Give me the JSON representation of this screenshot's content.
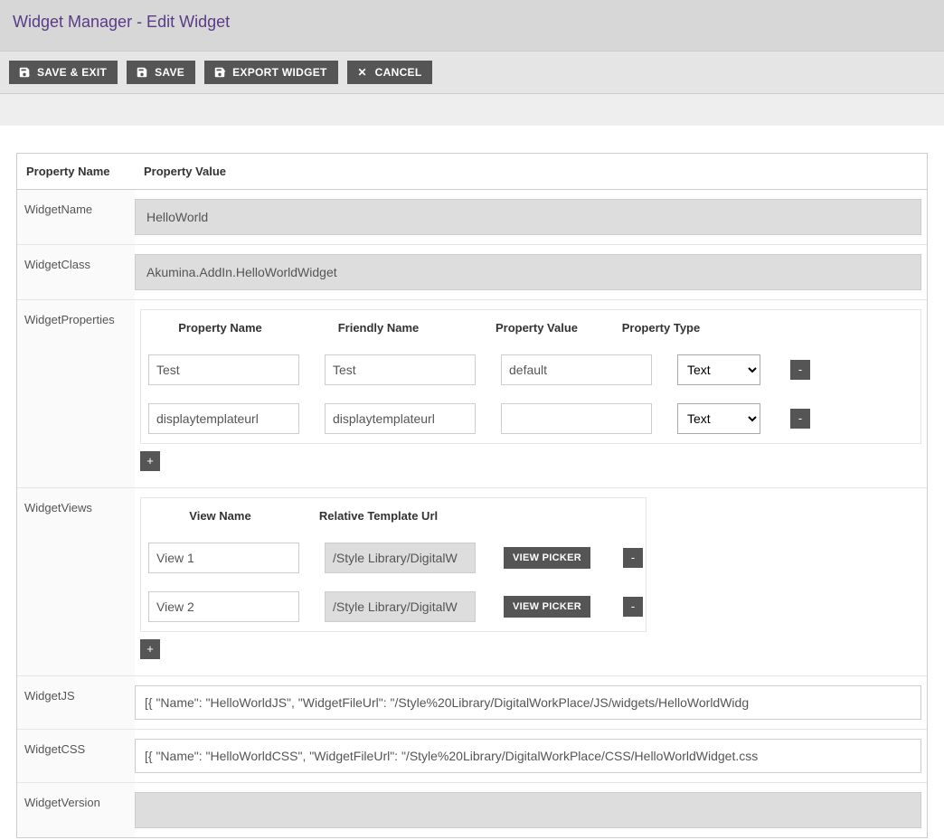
{
  "pageTitle": "Widget Manager - Edit Widget",
  "toolbar": {
    "saveExit": "SAVE & EXIT",
    "save": "SAVE",
    "export": "EXPORT WIDGET",
    "cancel": "CANCEL"
  },
  "headers": {
    "propertyName": "Property Name",
    "propertyValue": "Property Value"
  },
  "labels": {
    "widgetName": "WidgetName",
    "widgetClass": "WidgetClass",
    "widgetProperties": "WidgetProperties",
    "widgetViews": "WidgetViews",
    "widgetJS": "WidgetJS",
    "widgetCSS": "WidgetCSS",
    "widgetVersion": "WidgetVersion"
  },
  "values": {
    "widgetName": "HelloWorld",
    "widgetClass": "Akumina.AddIn.HelloWorldWidget",
    "widgetJS": "[{ \"Name\": \"HelloWorldJS\", \"WidgetFileUrl\": \"/Style%20Library/DigitalWorkPlace/JS/widgets/HelloWorldWidg",
    "widgetCSS": "[{ \"Name\": \"HelloWorldCSS\", \"WidgetFileUrl\": \"/Style%20Library/DigitalWorkPlace/CSS/HelloWorldWidget.css",
    "widgetVersion": ""
  },
  "propsTable": {
    "headers": {
      "name": "Property Name",
      "friendly": "Friendly Name",
      "value": "Property Value",
      "type": "Property Type"
    },
    "rows": [
      {
        "name": "Test",
        "friendly": "Test",
        "value": "default",
        "type": "Text"
      },
      {
        "name": "displaytemplateurl",
        "friendly": "displaytemplateurl",
        "value": "",
        "type": "Text"
      }
    ],
    "removeLabel": "-",
    "addLabel": "+"
  },
  "viewsTable": {
    "headers": {
      "name": "View Name",
      "url": "Relative Template Url"
    },
    "rows": [
      {
        "name": "View 1",
        "url": "/Style Library/DigitalW"
      },
      {
        "name": "View 2",
        "url": "/Style Library/DigitalW"
      }
    ],
    "pickerLabel": "VIEW PICKER",
    "removeLabel": "-",
    "addLabel": "+"
  }
}
